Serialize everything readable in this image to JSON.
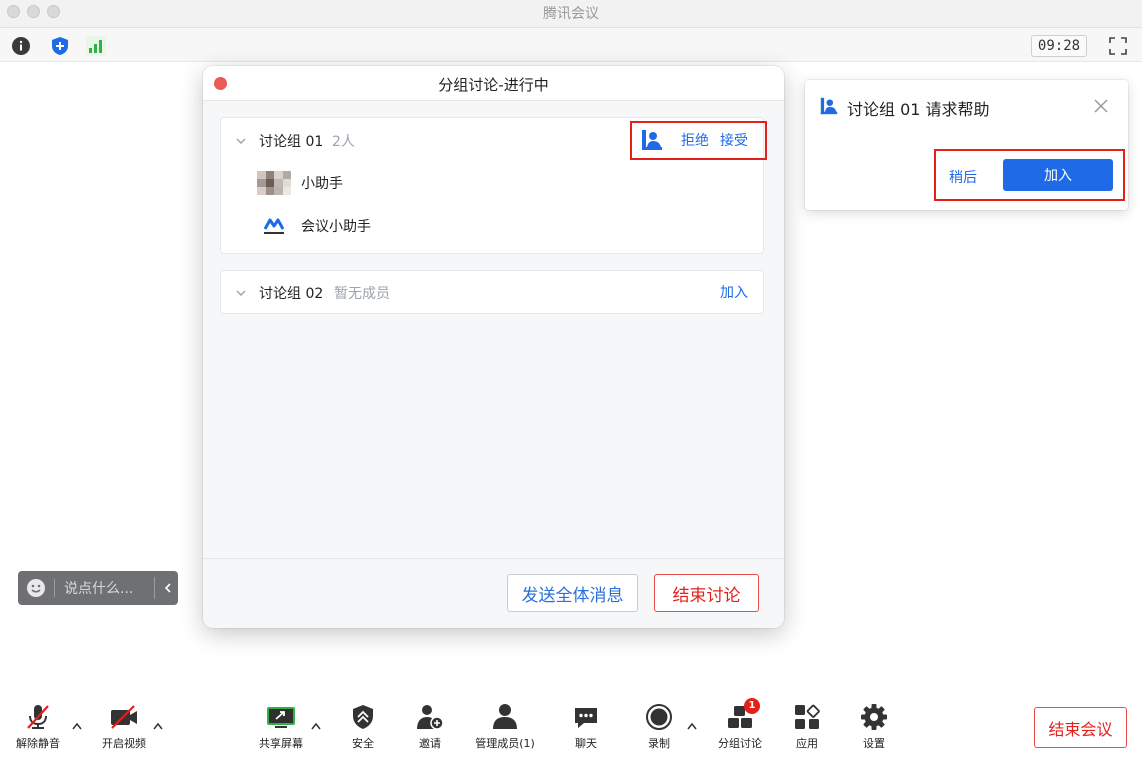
{
  "app": {
    "title": "腾讯会议"
  },
  "topbar": {
    "clock": "09:28"
  },
  "dialog": {
    "title": "分组讨论-进行中",
    "groups": [
      {
        "name": "讨论组 01",
        "count": "2人",
        "actions": {
          "reject": "拒绝",
          "accept": "接受"
        },
        "members": [
          {
            "name": "小助手",
            "avatar": "blurred-photo"
          },
          {
            "name": "会议小助手",
            "avatar": "tencent-meeting-logo"
          }
        ]
      },
      {
        "name": "讨论组 02",
        "count": "暂无成员",
        "action": "加入"
      }
    ],
    "footer": {
      "broadcast": "发送全体消息",
      "end_discussion": "结束讨论"
    }
  },
  "popup": {
    "title": "讨论组 01 请求帮助",
    "later": "稍后",
    "join": "加入"
  },
  "chat": {
    "placeholder": "说点什么..."
  },
  "toolbar": {
    "items": [
      {
        "label": "解除静音",
        "icon": "mic-muted-icon"
      },
      {
        "label": "开启视频",
        "icon": "camera-off-icon"
      },
      {
        "label": "共享屏幕",
        "icon": "share-screen-icon"
      },
      {
        "label": "安全",
        "icon": "shield-icon"
      },
      {
        "label": "邀请",
        "icon": "add-user-icon"
      },
      {
        "label": "管理成员(1)",
        "icon": "members-icon"
      },
      {
        "label": "聊天",
        "icon": "chat-icon"
      },
      {
        "label": "录制",
        "icon": "record-icon"
      },
      {
        "label": "分组讨论",
        "icon": "breakout-icon",
        "badge": "1"
      },
      {
        "label": "应用",
        "icon": "apps-icon"
      },
      {
        "label": "设置",
        "icon": "gear-icon"
      }
    ],
    "end_meeting": "结束会议"
  },
  "colors": {
    "accent": "#1f6ae6",
    "danger": "#e5201b",
    "success": "#2fb344"
  }
}
